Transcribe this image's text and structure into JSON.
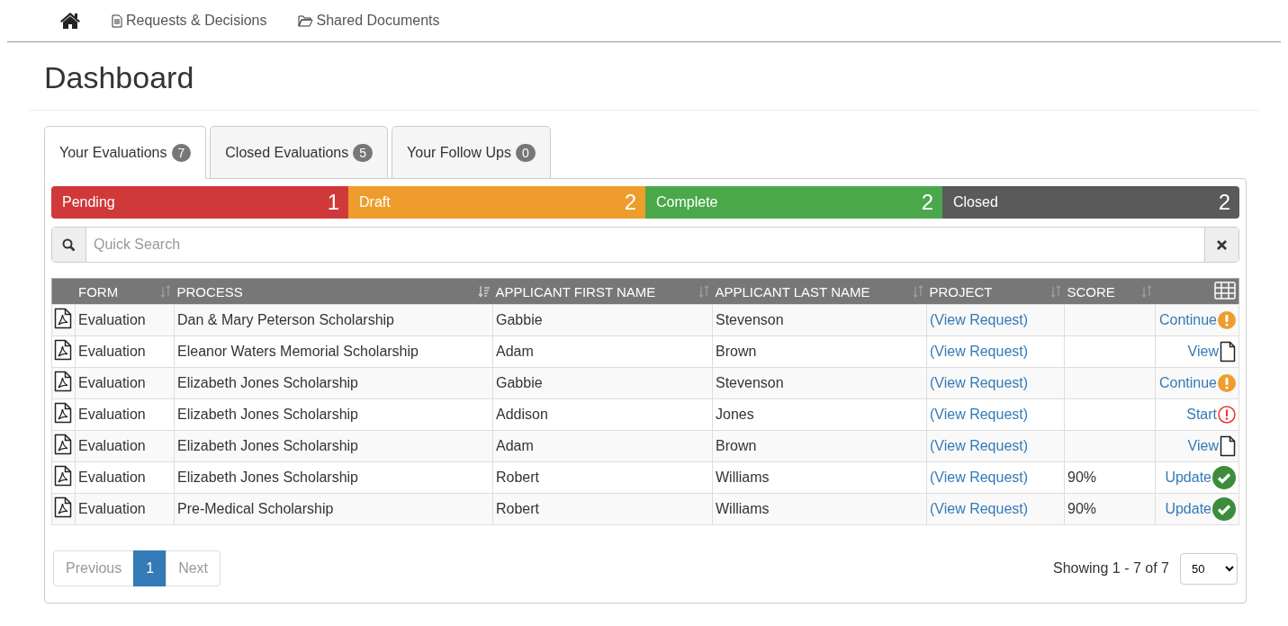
{
  "nav": [
    {
      "kind": "home"
    },
    {
      "kind": "file",
      "label": "Requests & Decisions"
    },
    {
      "kind": "folder",
      "label": "Shared Documents"
    }
  ],
  "title": "Dashboard",
  "tabs": [
    {
      "label": "Your Evaluations",
      "count": "7",
      "selected": true
    },
    {
      "label": "Closed Evaluations",
      "count": "5",
      "selected": false
    },
    {
      "label": "Your Follow Ups",
      "count": "0",
      "selected": false
    }
  ],
  "status_bar": [
    {
      "label": "Pending",
      "count": "1",
      "color": "#d0393a"
    },
    {
      "label": "Draft",
      "count": "2",
      "color": "#ee9d2c"
    },
    {
      "label": "Complete",
      "count": "2",
      "color": "#4aa84a"
    },
    {
      "label": "Closed",
      "count": "2",
      "color": "#5a5a5a"
    }
  ],
  "search": {
    "placeholder": "Quick Search"
  },
  "table": {
    "columns": [
      {
        "label": "FORM",
        "sorted": false
      },
      {
        "label": "PROCESS",
        "sorted": true
      },
      {
        "label": "APPLICANT FIRST NAME",
        "sorted": false
      },
      {
        "label": "APPLICANT LAST NAME",
        "sorted": false
      },
      {
        "label": "PROJECT",
        "sorted": false
      },
      {
        "label": "SCORE",
        "sorted": false
      }
    ],
    "rows": [
      {
        "form": "Evaluation",
        "process": "Dan & Mary Peterson Scholarship",
        "first": "Gabbie",
        "last": "Stevenson",
        "project": "(View Request)",
        "action": "Continue",
        "kind": "continue"
      },
      {
        "form": "Evaluation",
        "process": "Eleanor Waters Memorial Scholarship",
        "first": "Adam",
        "last": "Brown",
        "project": "(View Request)",
        "action": "View",
        "kind": "view"
      },
      {
        "form": "Evaluation",
        "process": "Elizabeth Jones Scholarship",
        "first": "Gabbie",
        "last": "Stevenson",
        "project": "(View Request)",
        "action": "Continue",
        "kind": "continue"
      },
      {
        "form": "Evaluation",
        "process": "Elizabeth Jones Scholarship",
        "first": "Addison",
        "last": "Jones",
        "project": "(View Request)",
        "action": "Start",
        "kind": "start"
      },
      {
        "form": "Evaluation",
        "process": "Elizabeth Jones Scholarship",
        "first": "Adam",
        "last": "Brown",
        "project": "(View Request)",
        "action": "View",
        "kind": "view"
      },
      {
        "form": "Evaluation",
        "process": "Elizabeth Jones Scholarship",
        "first": "Robert",
        "last": "Williams",
        "project": "(View Request)",
        "score": "90%",
        "action": "Update",
        "kind": "update"
      },
      {
        "form": "Evaluation",
        "process": "Pre-Medical Scholarship",
        "first": "Robert",
        "last": "Williams",
        "project": "(View Request)",
        "score": "90%",
        "action": "Update",
        "kind": "update"
      }
    ]
  },
  "pagination": {
    "previous": {
      "label": "Previous",
      "disabled": true
    },
    "pages": [
      {
        "label": "1",
        "selected": true
      }
    ],
    "next": {
      "label": "Next",
      "disabled": true
    },
    "summary": "Showing 1 - 7 of 7",
    "page_size": "50"
  }
}
